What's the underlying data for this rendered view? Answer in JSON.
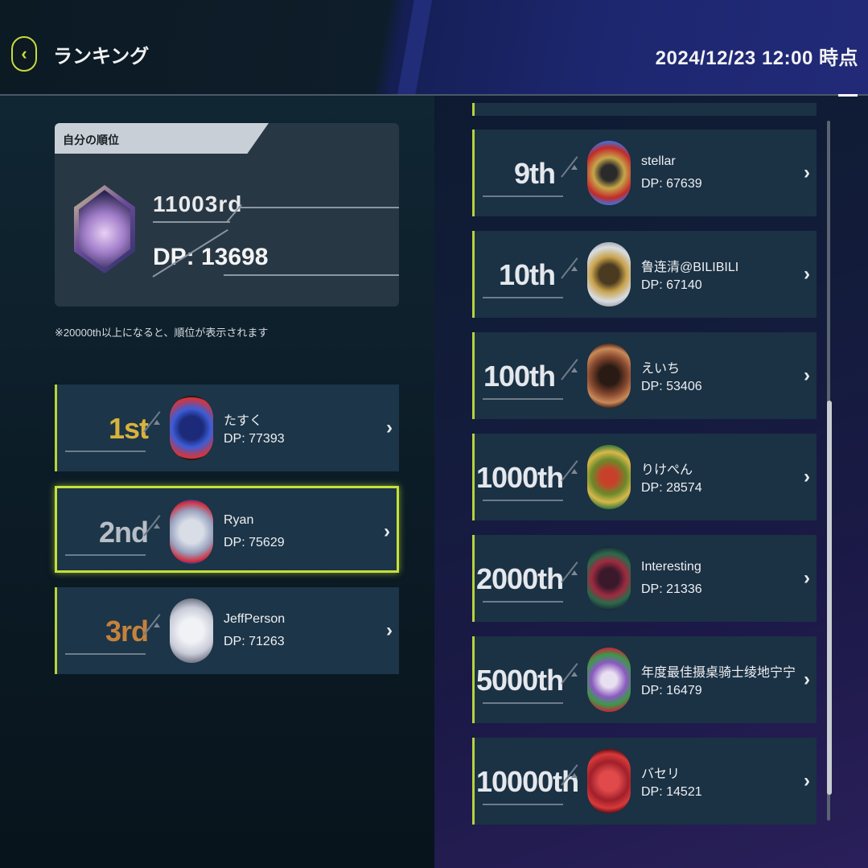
{
  "header": {
    "title": "ランキング",
    "timestamp": "2024/12/23 12:00 時点",
    "back_icon": "chevron-left-icon"
  },
  "my_rank": {
    "heading": "自分の順位",
    "rank": "11003rd",
    "dp": "DP: 13698",
    "note": "※20000th以上になると、順位が表示されます"
  },
  "top3": [
    {
      "rank": "1st",
      "name": "たすく",
      "dp": "DP: 77393",
      "color": "#d9b23c"
    },
    {
      "rank": "2nd",
      "name": "Ryan",
      "dp": "DP: 75629",
      "color": "#b8bec6"
    },
    {
      "rank": "3rd",
      "name": "JeffPerson",
      "dp": "DP: 71263",
      "color": "#c5823a"
    }
  ],
  "ranking_list": [
    {
      "rank": "9th",
      "name": "stellar",
      "dp": "DP: 67639"
    },
    {
      "rank": "10th",
      "name": "鲁连清@BILIBILI",
      "dp": "DP: 67140"
    },
    {
      "rank": "100th",
      "name": "えいち",
      "dp": "DP: 53406"
    },
    {
      "rank": "1000th",
      "name": "りけぺん",
      "dp": "DP: 28574"
    },
    {
      "rank": "2000th",
      "name": "Interesting",
      "dp": "DP: 21336"
    },
    {
      "rank": "5000th",
      "name": "年度最佳摄桌骑士绫地宁宁",
      "dp": "DP: 16479"
    },
    {
      "rank": "10000th",
      "name": "バセリ",
      "dp": "DP: 14521"
    }
  ],
  "chevron": "›",
  "accent_color": "#c4e03a"
}
